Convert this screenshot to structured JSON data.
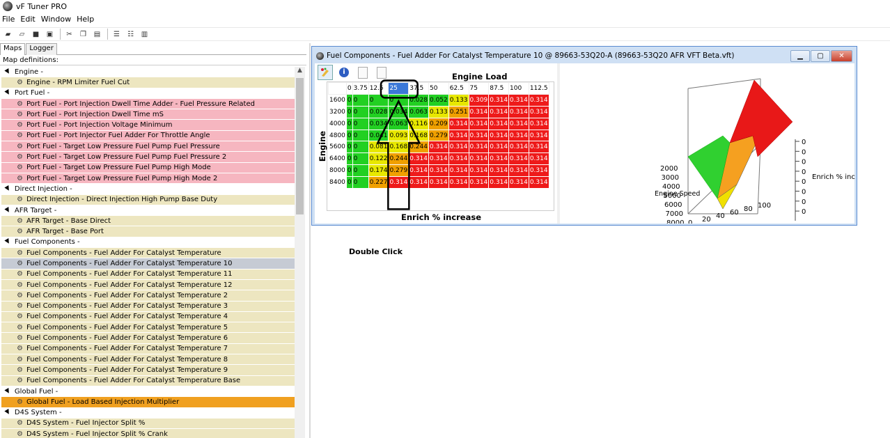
{
  "app": {
    "title": "vF Tuner PRO",
    "icon": "app-logo-icon"
  },
  "menu": [
    "File",
    "Edit",
    "Window",
    "Help"
  ],
  "toolbar": [
    {
      "name": "open-folder-icon",
      "glyph": "▰"
    },
    {
      "name": "open-icon",
      "glyph": "▱"
    },
    {
      "name": "save-icon",
      "glyph": "■"
    },
    {
      "name": "save-as-icon",
      "glyph": "▣"
    },
    {
      "name": "cut-icon",
      "glyph": "✂"
    },
    {
      "name": "copy-icon",
      "glyph": "❐"
    },
    {
      "name": "paste-icon",
      "glyph": "▤"
    },
    {
      "name": "cascade-icon",
      "glyph": "☰"
    },
    {
      "name": "tile-horizontal-icon",
      "glyph": "☷"
    },
    {
      "name": "tile-vertical-icon",
      "glyph": "▥"
    }
  ],
  "left": {
    "tabs": [
      "Maps",
      "Logger"
    ],
    "header": "Map definitions:",
    "tree": [
      {
        "type": "cat",
        "label": "Engine -"
      },
      {
        "type": "item",
        "label": "Engine - RPM Limiter Fuel Cut"
      },
      {
        "type": "cat",
        "label": "Port Fuel -"
      },
      {
        "type": "item",
        "style": "pink",
        "label": "Port Fuel - Port Injection Dwell Time Adder - Fuel Pressure Related"
      },
      {
        "type": "item",
        "style": "pink",
        "label": "Port Fuel - Port Injection Dwell Time mS"
      },
      {
        "type": "item",
        "style": "pink",
        "label": "Port Fuel - Port Injection Voltage Minimum"
      },
      {
        "type": "item",
        "style": "pink",
        "label": "Port Fuel - Port Injector Fuel Adder For Throttle Angle"
      },
      {
        "type": "item",
        "style": "pink",
        "label": "Port Fuel - Target Low Pressure Fuel Pump Fuel Pressure"
      },
      {
        "type": "item",
        "style": "pink",
        "label": "Port Fuel - Target Low Pressure Fuel Pump Fuel Pressure 2"
      },
      {
        "type": "item",
        "style": "pink",
        "label": "Port Fuel - Target Low Pressure Fuel Pump High Mode"
      },
      {
        "type": "item",
        "style": "pink",
        "label": "Port Fuel - Target Low Pressure Fuel Pump High Mode 2"
      },
      {
        "type": "cat",
        "label": "Direct Injection -"
      },
      {
        "type": "item",
        "label": "Direct Injection - Direct Injection High Pump Base Duty"
      },
      {
        "type": "cat",
        "label": "AFR Target -"
      },
      {
        "type": "item",
        "label": "AFR Target - Base Direct"
      },
      {
        "type": "item",
        "label": "AFR Target - Base Port"
      },
      {
        "type": "cat",
        "label": "Fuel Components -"
      },
      {
        "type": "item",
        "label": "Fuel Components - Fuel Adder For Catalyst Temperature"
      },
      {
        "type": "item",
        "style": "sel",
        "label": "Fuel Components - Fuel Adder For Catalyst Temperature 10"
      },
      {
        "type": "item",
        "label": "Fuel Components - Fuel Adder For Catalyst Temperature 11"
      },
      {
        "type": "item",
        "label": "Fuel Components - Fuel Adder For Catalyst Temperature 12"
      },
      {
        "type": "item",
        "label": "Fuel Components - Fuel Adder For Catalyst Temperature 2"
      },
      {
        "type": "item",
        "label": "Fuel Components - Fuel Adder For Catalyst Temperature 3"
      },
      {
        "type": "item",
        "label": "Fuel Components - Fuel Adder For Catalyst Temperature 4"
      },
      {
        "type": "item",
        "label": "Fuel Components - Fuel Adder For Catalyst Temperature 5"
      },
      {
        "type": "item",
        "label": "Fuel Components - Fuel Adder For Catalyst Temperature 6"
      },
      {
        "type": "item",
        "label": "Fuel Components - Fuel Adder For Catalyst Temperature 7"
      },
      {
        "type": "item",
        "label": "Fuel Components - Fuel Adder For Catalyst Temperature 8"
      },
      {
        "type": "item",
        "label": "Fuel Components - Fuel Adder For Catalyst Temperature 9"
      },
      {
        "type": "item",
        "label": "Fuel Components - Fuel Adder For Catalyst Temperature Base"
      },
      {
        "type": "cat",
        "label": "Global Fuel -"
      },
      {
        "type": "item",
        "style": "orange",
        "label": "Global Fuel - Load Based Injection Multiplier"
      },
      {
        "type": "cat",
        "label": "D4S System -"
      },
      {
        "type": "item",
        "label": "D4S System - Fuel Injector Split %"
      },
      {
        "type": "item",
        "label": "D4S System - Fuel Injector Split % Crank"
      }
    ]
  },
  "window": {
    "title": "Fuel Components - Fuel Adder For Catalyst Temperature 10 @ 89663-53Q20-A (89663-53Q20 AFR VFT Beta.vft)",
    "buttons": {
      "minimize": "▁",
      "maximize": "▢",
      "close": "✕"
    },
    "tools": [
      "palette-icon",
      "info-icon",
      "page-icon",
      "page-icon"
    ],
    "info_glyph": "i",
    "grid": {
      "title": "Engine Load",
      "ylabel": "Engine Speed",
      "xlabel": "Enrich % increase",
      "columns": [
        "0",
        "3.75",
        "12.5",
        "25",
        "37.5",
        "50",
        "62.5",
        "75",
        "87.5",
        "100",
        "112.5"
      ],
      "selected_column_label": "25",
      "rows": [
        "1600",
        "3200",
        "4000",
        "4800",
        "5600",
        "6400",
        "8000",
        "8400"
      ],
      "values": [
        [
          "0",
          "0",
          "0",
          "0",
          "0.028",
          "0.052",
          "0.133",
          "0.309",
          "0.314",
          "0.314",
          "0.314"
        ],
        [
          "0",
          "0",
          "0.028",
          "0.034",
          "0.063",
          "0.133",
          "0.251",
          "0.314",
          "0.314",
          "0.314",
          "0.314"
        ],
        [
          "0",
          "0",
          "0.034",
          "0.063",
          "0.116",
          "0.209",
          "0.314",
          "0.314",
          "0.314",
          "0.314",
          "0.314"
        ],
        [
          "0",
          "0",
          "0.041",
          "0.093",
          "0.168",
          "0.279",
          "0.314",
          "0.314",
          "0.314",
          "0.314",
          "0.314"
        ],
        [
          "0",
          "0",
          "0.081",
          "0.168",
          "0.244",
          "0.314",
          "0.314",
          "0.314",
          "0.314",
          "0.314",
          "0.314"
        ],
        [
          "0",
          "0",
          "0.122",
          "0.244",
          "0.314",
          "0.314",
          "0.314",
          "0.314",
          "0.314",
          "0.314",
          "0.314"
        ],
        [
          "0",
          "0",
          "0.174",
          "0.279",
          "0.314",
          "0.314",
          "0.314",
          "0.314",
          "0.314",
          "0.314",
          "0.314"
        ],
        [
          "0",
          "0",
          "0.227",
          "0.314",
          "0.314",
          "0.314",
          "0.314",
          "0.314",
          "0.314",
          "0.314",
          "0.314"
        ]
      ]
    },
    "plot": {
      "z_ticks": [
        "0",
        "0",
        "0",
        "0",
        "0",
        "0",
        "0",
        "0"
      ],
      "z_label": "Enrich % increase",
      "speed_ticks": [
        "2000",
        "3000",
        "4000",
        "5000",
        "6000",
        "7000",
        "8000"
      ],
      "speed_label": "Engine Speed",
      "load_ticks": [
        "0",
        "20",
        "40",
        "60",
        "80",
        "100"
      ],
      "load_label": "Engine Load"
    }
  },
  "annotation": {
    "text": "Double Click"
  },
  "colors": {
    "green": "#22d022",
    "yellow": "#e8e800",
    "orange": "#f0a000",
    "red": "#ee1a1a",
    "selected_row": "#c6cbd4",
    "pink": "#f6b6c0",
    "item": "#ede6c0"
  }
}
